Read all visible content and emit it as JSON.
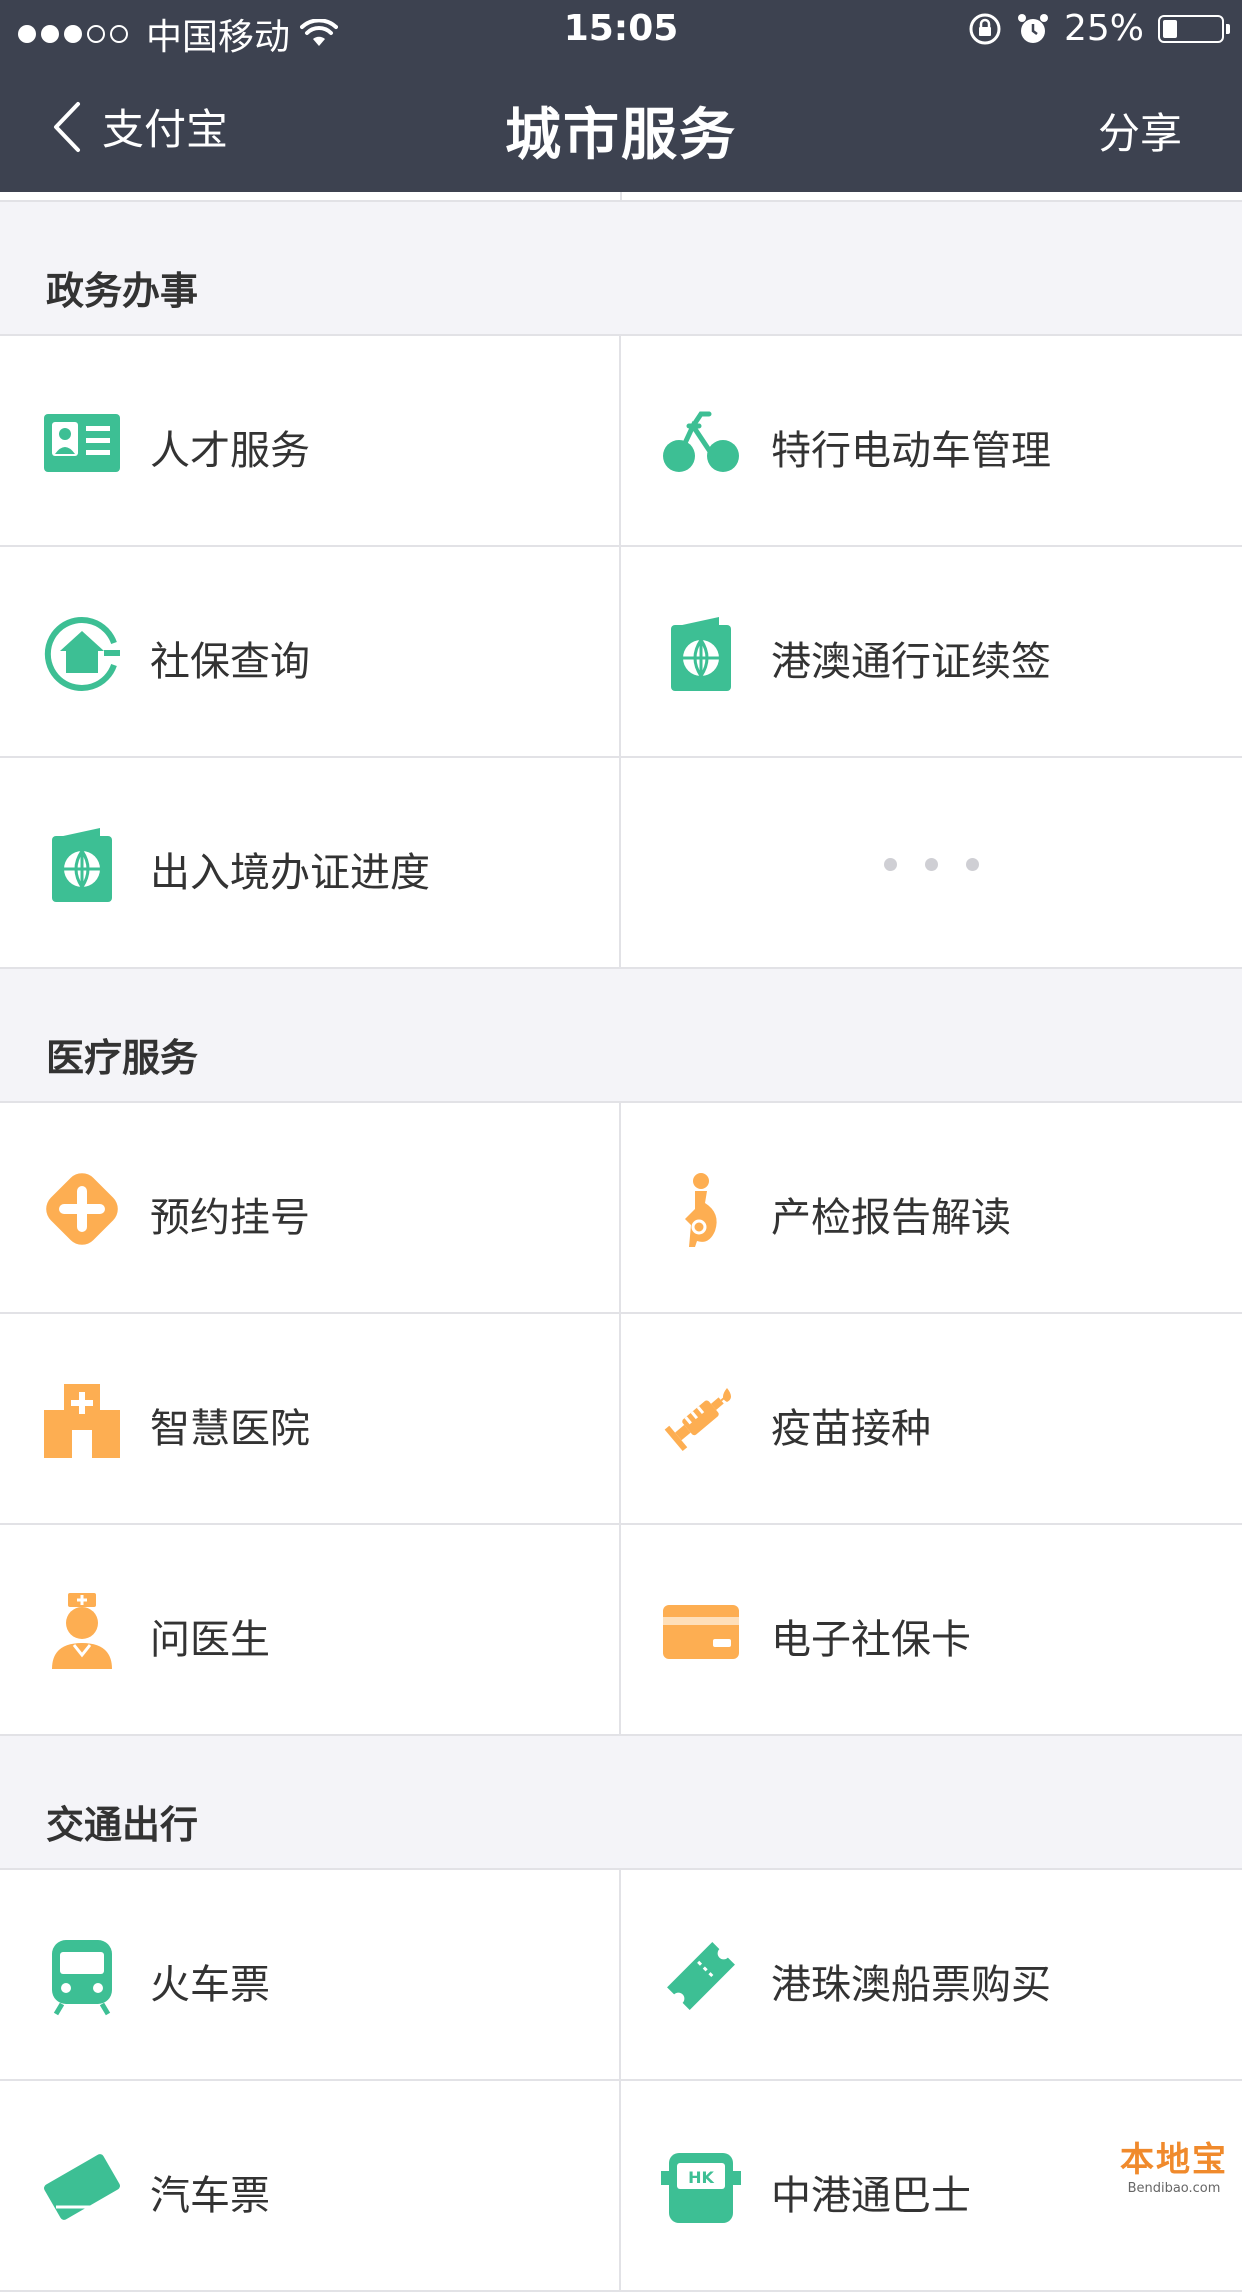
{
  "status_bar": {
    "carrier": "中国移动",
    "time": "15:05",
    "battery": "25%",
    "battery_level": 0.25
  },
  "nav": {
    "back_label": "支付宝",
    "title": "城市服务",
    "share_label": "分享"
  },
  "sections": [
    {
      "title": "政务办事",
      "color": "#3dbf94",
      "items": [
        {
          "label": "人才服务",
          "icon": "id-card-icon"
        },
        {
          "label": "特行电动车管理",
          "icon": "bicycle-icon"
        },
        {
          "label": "社保查询",
          "icon": "home-circle-icon"
        },
        {
          "label": "港澳通行证续签",
          "icon": "passport-icon"
        },
        {
          "label": "出入境办证进度",
          "icon": "passport-icon"
        }
      ]
    },
    {
      "title": "医疗服务",
      "color": "#fdae52",
      "items": [
        {
          "label": "预约挂号",
          "icon": "medical-cross-icon"
        },
        {
          "label": "产检报告解读",
          "icon": "pregnancy-icon"
        },
        {
          "label": "智慧医院",
          "icon": "hospital-icon"
        },
        {
          "label": "疫苗接种",
          "icon": "syringe-icon"
        },
        {
          "label": "问医生",
          "icon": "nurse-icon"
        },
        {
          "label": "电子社保卡",
          "icon": "card-icon"
        }
      ]
    },
    {
      "title": "交通出行",
      "color": "#3dbf94",
      "items": [
        {
          "label": "火车票",
          "icon": "train-icon"
        },
        {
          "label": "港珠澳船票购买",
          "icon": "ticket-icon"
        },
        {
          "label": "汽车票",
          "icon": "bus-ticket-icon"
        },
        {
          "label": "中港通巴士",
          "icon": "hk-bus-icon"
        }
      ]
    }
  ],
  "watermark": {
    "line1": "本地宝",
    "line2": "Bendibao.com"
  }
}
